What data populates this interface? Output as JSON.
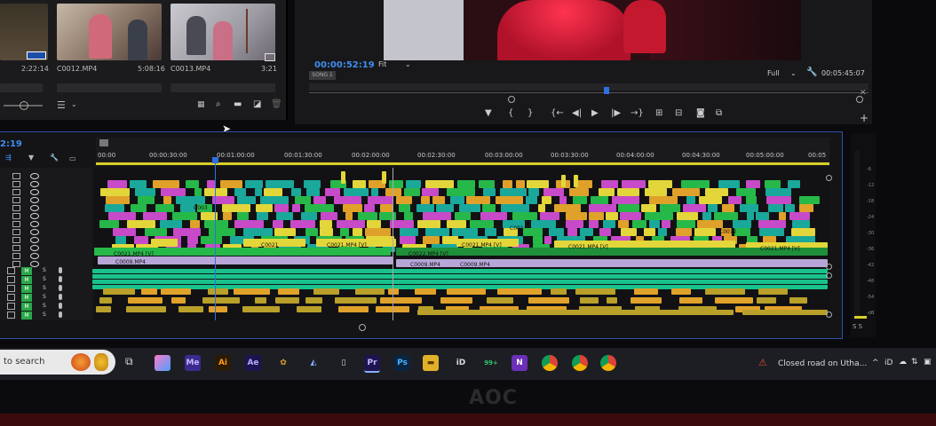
{
  "colors": {
    "accent": "#3d8ef0",
    "playhead": "#2f6fe0",
    "panel_border": "#3151a8",
    "yellow": "#e3d63a",
    "teal": "#1aa89a",
    "magenta": "#c74ac8",
    "orange": "#e0a12a",
    "green": "#27b84a",
    "lavender": "#b8a6d8",
    "audio_green": "#19c28c"
  },
  "project": {
    "items": [
      {
        "name": "",
        "duration": "2:22:14"
      },
      {
        "name": "C0012.MP4",
        "duration": "5:08:16"
      },
      {
        "name": "C0013.MP4",
        "duration": "3:21"
      }
    ]
  },
  "program": {
    "timecode": "00:00:52:19",
    "zoom": "Fit",
    "resolution": "Full",
    "duration": "00:05:45:07",
    "marker": "SONG 1"
  },
  "timeline": {
    "timecode": "2:19",
    "ruler": [
      "00:00",
      "00:00:30:00",
      "00:01:00:00",
      "00:01:30:00",
      "00:02:00:00",
      "00:02:30:00",
      "00:03:00:00",
      "00:03:30:00",
      "00:04:00:00",
      "00:04:30:00",
      "00:05:00:00",
      "00:05"
    ],
    "clip_labels": {
      "c0021_v_a": "C0021.MP4 [V]",
      "c0021_v_b": "C0021.MP4 [V]",
      "c0021_v_c": "C0021.MP4 [V]",
      "c0021_v_d": "C0021.MP4 [V]",
      "c0021_v_e": "C0021.MP4 [V]",
      "c0009_a": "C0009.MP4",
      "c0009_b": "C0009.MP4",
      "c0009_c": "C0009.MP4",
      "c0009_d": "C0009.MP4",
      "c0003": "C003",
      "c001": "C001",
      "c0012": "C0012",
      "c0021": "C0021",
      "c002": "C002",
      "c0021_v_f": "C0021.MP4 [V]",
      "c0022_v": "C0022.MP4 [V]"
    },
    "track_m": "M",
    "track_s": "S"
  },
  "meter": {
    "ticks": [
      "-6",
      "-12",
      "-18",
      "-24",
      "-30",
      "-36",
      "-42",
      "-48",
      "-54",
      "-dB"
    ],
    "solo": "S S"
  },
  "taskbar": {
    "search_placeholder": "to search",
    "apps": [
      {
        "label": "Me",
        "color": "#3b2a8f"
      },
      {
        "label": "Ai",
        "color": "#2b1a05"
      },
      {
        "label": "Ae",
        "color": "#1a1550"
      },
      {
        "label": "Pr",
        "color": "#1e1550"
      },
      {
        "label": "Ps",
        "color": "#0b2540"
      },
      {
        "label": "iD",
        "color": "#1d1e24"
      },
      {
        "label": "99+",
        "color": "#1d1e24"
      },
      {
        "label": "N",
        "color": "#6b2fb8"
      }
    ],
    "notification": "Closed road on Utha...",
    "tray_text": "iD"
  },
  "bezel": {
    "brand": "AOC"
  }
}
